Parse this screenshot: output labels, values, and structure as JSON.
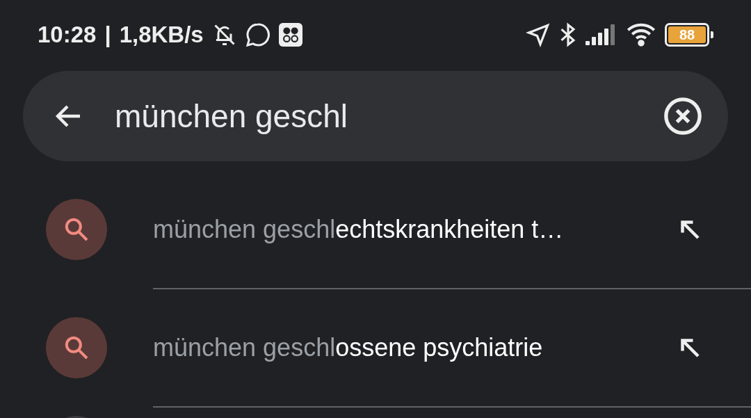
{
  "status_bar": {
    "time": "10:28",
    "separator": "|",
    "speed": "1,8KB/s",
    "battery": "88"
  },
  "search": {
    "value": "münchen geschl"
  },
  "suggestions": [
    {
      "kind": "query",
      "matched": "münchen geschl",
      "completion": "echtskrankheiten t…"
    },
    {
      "kind": "query",
      "matched": "münchen geschl",
      "completion": "ossene psychiatrie"
    },
    {
      "kind": "cut"
    }
  ]
}
